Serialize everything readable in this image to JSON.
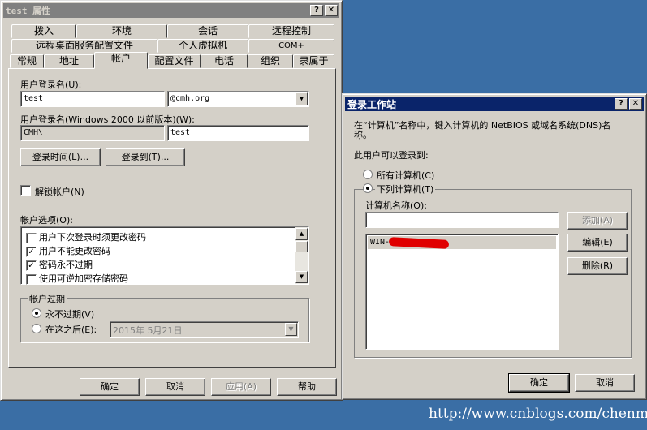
{
  "props_window": {
    "title": "test 属性",
    "help_glyph": "?",
    "close_glyph": "✕",
    "tabs_row1": [
      "拨入",
      "环境",
      "会话",
      "远程控制"
    ],
    "tabs_row2": [
      "远程桌面服务配置文件",
      "个人虚拟机",
      "COM+"
    ],
    "tabs_row3": [
      "常规",
      "地址",
      "帐户",
      "配置文件",
      "电话",
      "组织",
      "隶属于"
    ],
    "logon_name_label": "用户登录名(U):",
    "logon_name_value": "test",
    "domain_value": "@cmh.org",
    "pre2000_label": "用户登录名(Windows 2000 以前版本)(W):",
    "pre2000_domain": "CMH\\",
    "pre2000_name": "test",
    "logon_hours_button": "登录时间(L)...",
    "logon_to_button": "登录到(T)...",
    "unlock_label": "解锁帐户(N)",
    "account_options_label": "帐户选项(O):",
    "account_options": [
      {
        "label": "用户下次登录时须更改密码",
        "checked": false
      },
      {
        "label": "用户不能更改密码",
        "checked": true
      },
      {
        "label": "密码永不过期",
        "checked": true
      },
      {
        "label": "使用可逆加密存储密码",
        "checked": false
      }
    ],
    "expiry_group": "帐户过期",
    "never_label": "永不过期(V)",
    "end_of_label": "在这之后(E):",
    "expiry_date": "2015年  5月21日",
    "ok": "确定",
    "cancel": "取消",
    "apply": "应用(A)",
    "help": "帮助"
  },
  "logon_dialog": {
    "title": "登录工作站",
    "help_glyph": "?",
    "close_glyph": "✕",
    "description": "在“计算机”名称中，键入计算机的 NetBIOS 或域名系统(DNS)名称。",
    "can_log_on_label": "此用户可以登录到:",
    "all_computers": "所有计算机(C)",
    "following_computers": "下列计算机(T)",
    "computer_name_label": "计算机名称(O):",
    "computer_name_value": "",
    "add": "添加(A)",
    "edit": "编辑(E)",
    "remove": "删除(R)",
    "computers": [
      "WIN-"
    ],
    "ok": "确定",
    "cancel": "取消"
  },
  "watermark": "http://www.cnblogs.com/chenmh/",
  "colors": {
    "desktop": "#3a6ea5",
    "face": "#d4d0c8",
    "active_title": "#0a246a",
    "inactive_title": "#808080",
    "redaction": "#e00000"
  }
}
